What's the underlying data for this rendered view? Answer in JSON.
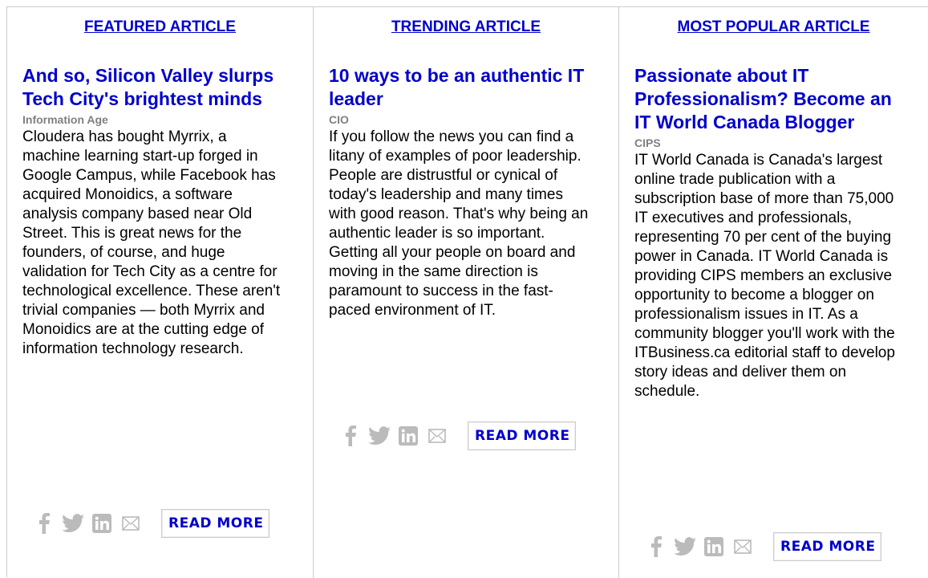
{
  "columns": [
    {
      "header": "FEATURED ARTICLE",
      "title": "And so, Silicon Valley slurps Tech City's brightest minds",
      "source": "Information Age",
      "body": "Cloudera has bought Myrrix, a machine learning start-up forged in Google Campus, while Facebook has acquired Monoidics, a software analysis company based near Old Street. This is great news for the founders, of course, and huge validation for Tech City as a centre for technological excellence. These aren't trivial companies — both Myrrix and Monoidics are at the cutting edge of information technology research.",
      "read_more": "READ MORE"
    },
    {
      "header": "TRENDING ARTICLE",
      "title": "10 ways to be an authentic IT leader",
      "source": "CIO",
      "body": "If you follow the news you can find a litany of examples of poor leadership. People are distrustful or cynical of today's leadership and many times with good reason. That's why being an authentic leader is so important. Getting all your people on board and moving in the same direction is paramount to success in the fast-paced environment of IT.",
      "read_more": "READ MORE"
    },
    {
      "header": "MOST POPULAR ARTICLE",
      "title": "Passionate about IT Professionalism? Become an IT World Canada Blogger",
      "source": "CIPS",
      "body": "IT World Canada is Canada's largest online trade publication with a subscription base of more than 75,000 IT executives and professionals, representing 70 per cent of the buying power in Canada. IT World Canada is providing CIPS members an exclusive opportunity to become a blogger on professionalism issues in IT. As a community blogger you'll work with the ITBusiness.ca editorial staff to develop story ideas and deliver them on schedule.",
      "read_more": "READ MORE"
    }
  ],
  "share_icons": [
    "facebook-icon",
    "twitter-icon",
    "linkedin-icon",
    "email-icon"
  ],
  "colors": {
    "link": "#0000cc",
    "source": "#808080",
    "icon": "#bbbbbb",
    "border": "#cccccc"
  }
}
